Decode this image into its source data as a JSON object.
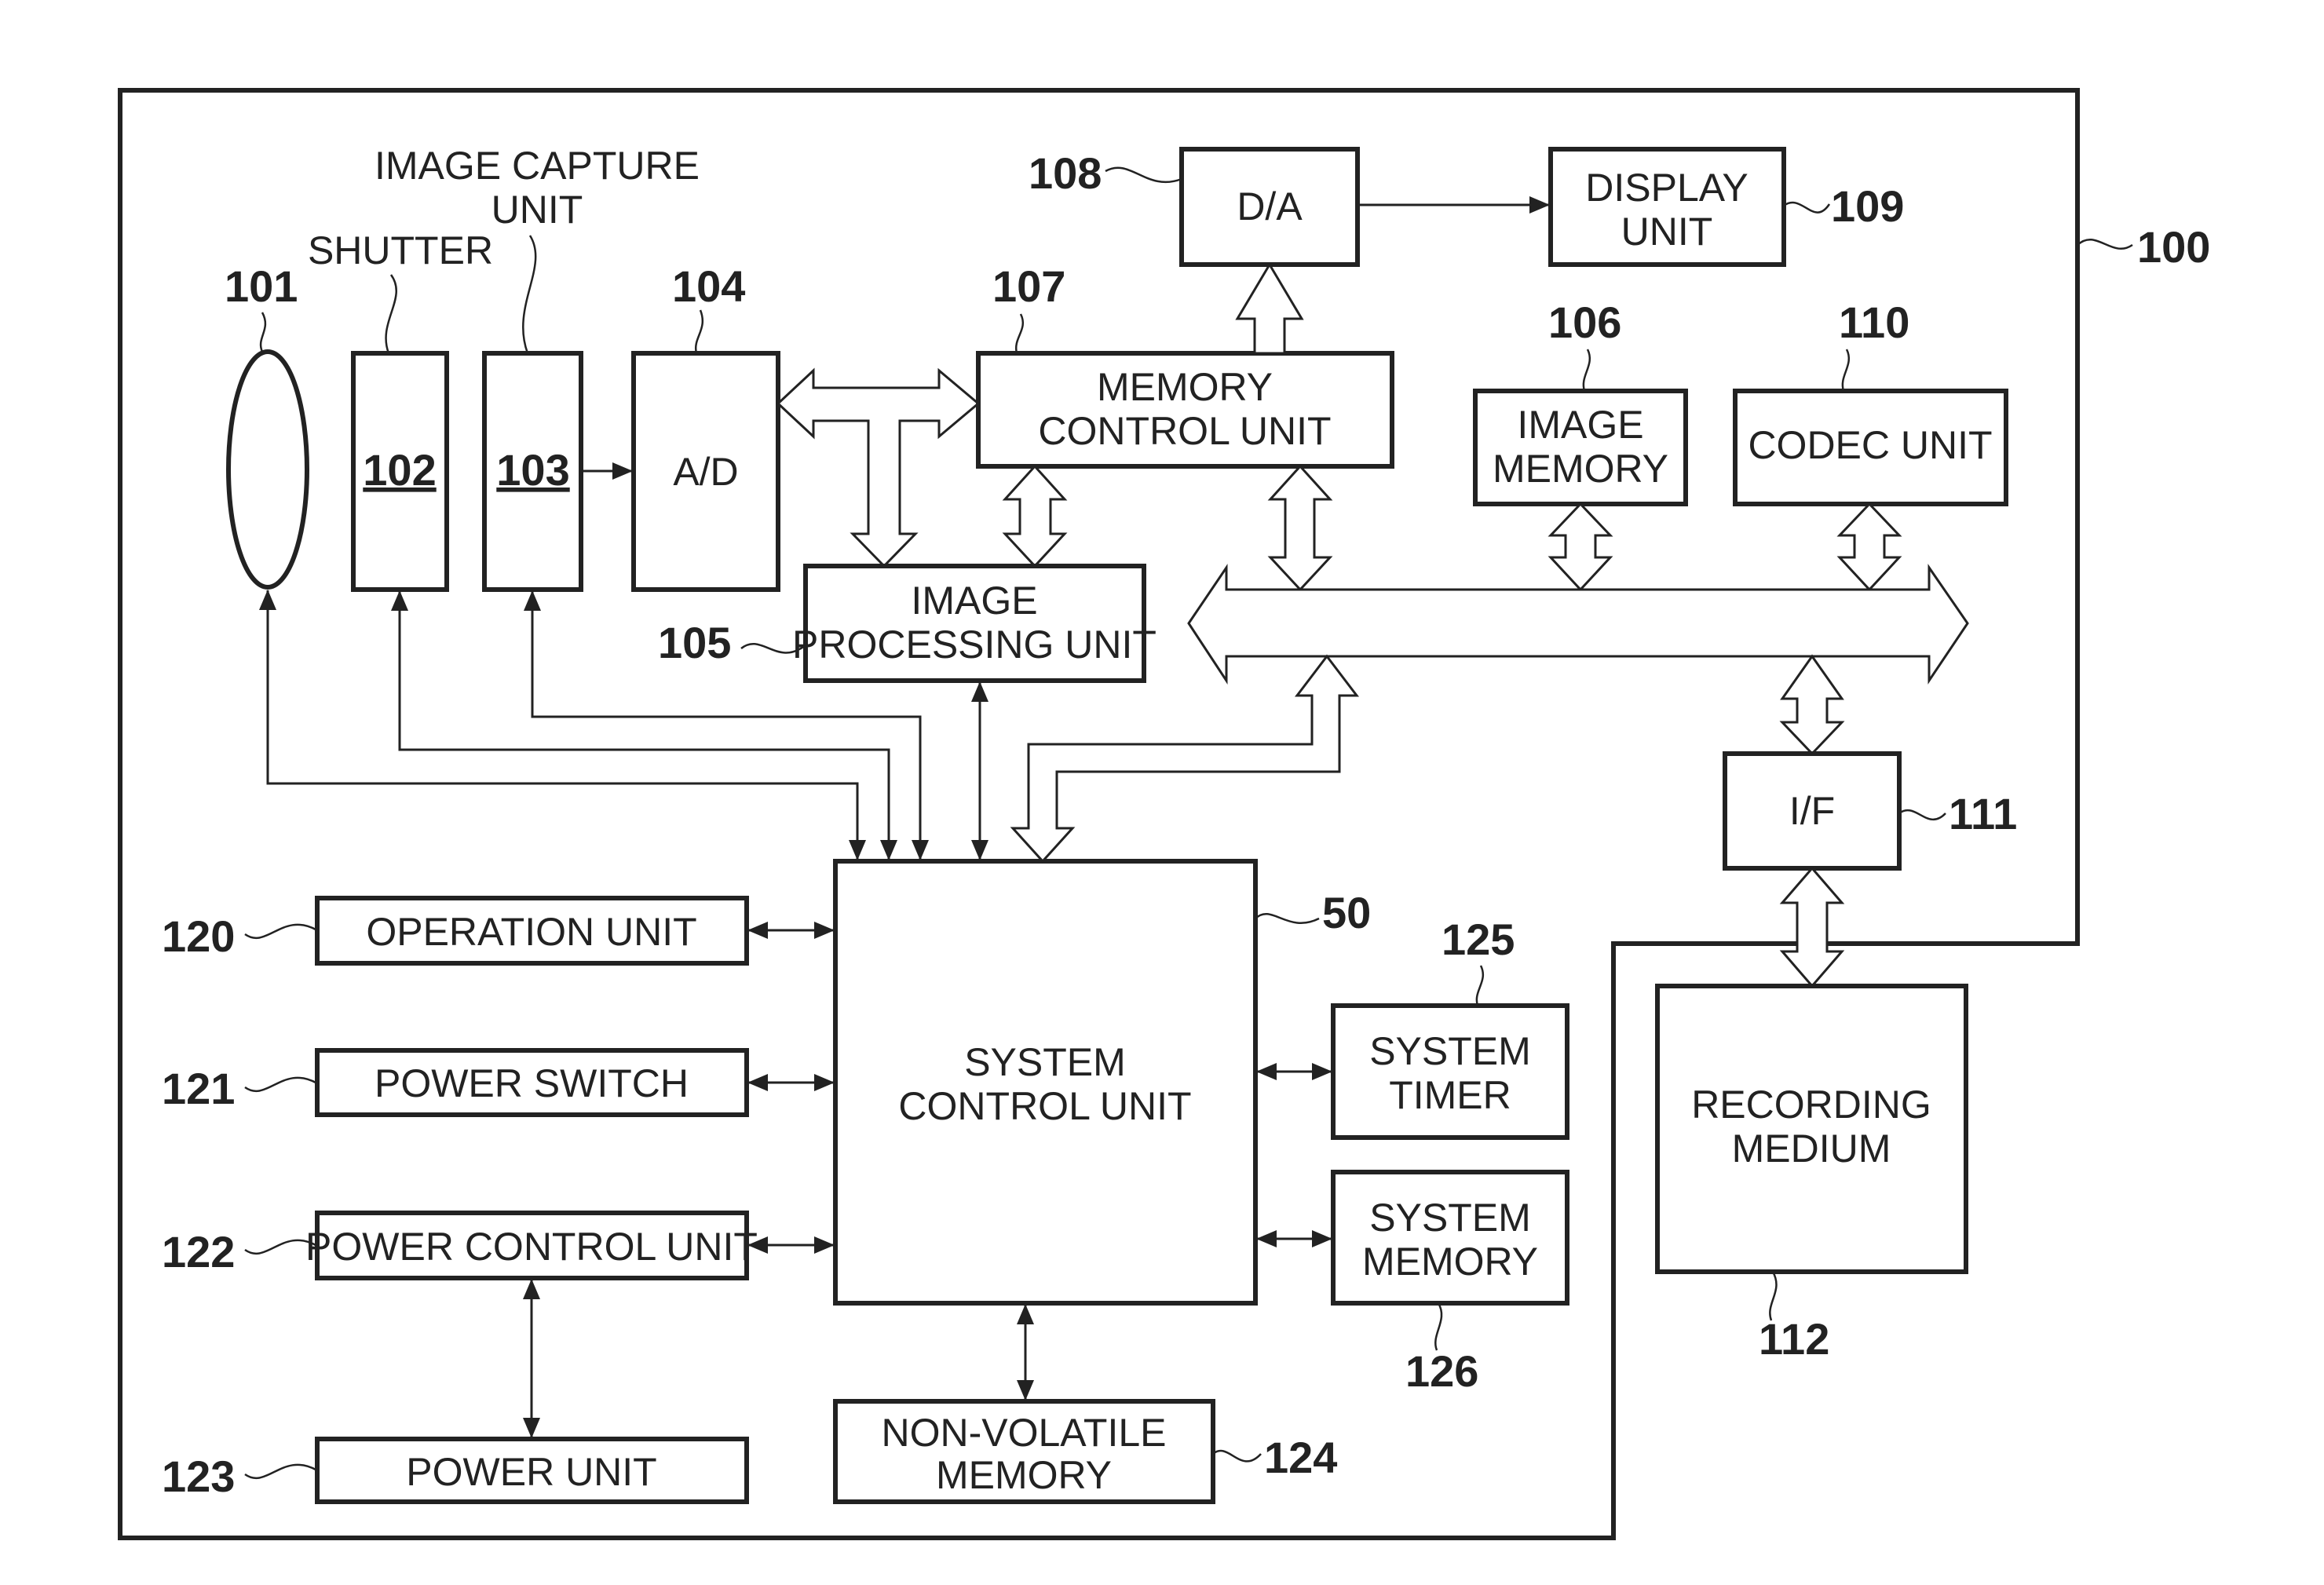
{
  "figure": {
    "device_ref": "100",
    "blocks": {
      "lens": {
        "ref": "101"
      },
      "shutter": {
        "ref": "102",
        "caption": "SHUTTER",
        "inner_label": "102"
      },
      "image_capture": {
        "ref": "103",
        "caption_line1": "IMAGE CAPTURE",
        "caption_line2": "UNIT",
        "inner_label": "103"
      },
      "ad": {
        "ref": "104",
        "label": "A/D"
      },
      "image_processing": {
        "ref": "105",
        "line1": "IMAGE",
        "line2": "PROCESSING UNIT"
      },
      "image_memory": {
        "ref": "106",
        "line1": "IMAGE",
        "line2": "MEMORY"
      },
      "memory_control": {
        "ref": "107",
        "line1": "MEMORY",
        "line2": "CONTROL UNIT"
      },
      "da": {
        "ref": "108",
        "label": "D/A"
      },
      "display": {
        "ref": "109",
        "line1": "DISPLAY",
        "line2": "UNIT"
      },
      "codec": {
        "ref": "110",
        "label": "CODEC UNIT"
      },
      "interface": {
        "ref": "111",
        "label": "I/F"
      },
      "recording_medium": {
        "ref": "112",
        "line1": "RECORDING",
        "line2": "MEDIUM"
      },
      "system_control": {
        "ref": "50",
        "line1": "SYSTEM",
        "line2": "CONTROL UNIT"
      },
      "operation": {
        "ref": "120",
        "label": "OPERATION UNIT"
      },
      "power_switch": {
        "ref": "121",
        "label": "POWER SWITCH"
      },
      "power_control": {
        "ref": "122",
        "label": "POWER CONTROL UNIT"
      },
      "power_unit": {
        "ref": "123",
        "label": "POWER UNIT"
      },
      "non_volatile": {
        "ref": "124",
        "line1": "NON-VOLATILE",
        "line2": "MEMORY"
      },
      "system_timer": {
        "ref": "125",
        "line1": "SYSTEM",
        "line2": "TIMER"
      },
      "system_memory": {
        "ref": "126",
        "line1": "SYSTEM",
        "line2": "MEMORY"
      }
    }
  }
}
